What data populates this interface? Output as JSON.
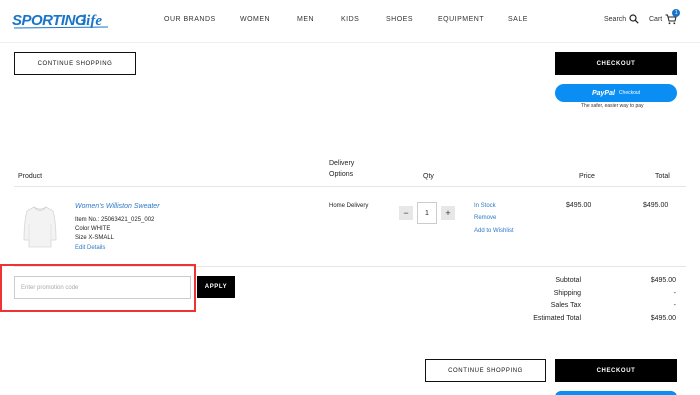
{
  "header": {
    "logo_text": "SPORTING LIFE",
    "nav": [
      "OUR BRANDS",
      "WOMEN",
      "MEN",
      "KIDS",
      "SHOES",
      "EQUIPMENT",
      "SALE"
    ],
    "search_label": "Search",
    "cart_label": "Cart",
    "cart_count": "1"
  },
  "top_actions": {
    "continue_label": "CONTINUE SHOPPING",
    "checkout_label": "CHECKOUT",
    "paypal_label": "PayPal",
    "paypal_sub": "Checkout",
    "paypal_caption": "The safer, easier way to pay"
  },
  "table": {
    "headers": {
      "product": "Product",
      "delivery_line1": "Delivery",
      "delivery_line2": "Options",
      "qty": "Qty",
      "price": "Price",
      "total": "Total"
    },
    "item": {
      "name": "Women's Williston Sweater",
      "item_no": "Item No.: 25063421_025_002",
      "color": "Color WHITE",
      "size": "Size X-SMALL",
      "edit_label": "Edit Details",
      "delivery": "Home Delivery",
      "qty_minus": "−",
      "qty_value": "1",
      "qty_plus": "+",
      "stock": "In Stock",
      "remove": "Remove",
      "wishlist": "Add to Wishlist",
      "price": "$495.00",
      "total": "$495.00"
    }
  },
  "promo": {
    "placeholder": "Enter promotion code",
    "apply_label": "APPLY"
  },
  "summary": {
    "subtotal_label": "Subtotal",
    "subtotal": "$495.00",
    "shipping_label": "Shipping",
    "shipping": "-",
    "tax_label": "Sales Tax",
    "tax": "-",
    "estimated_label": "Estimated Total",
    "estimated": "$495.00"
  },
  "bottom_actions": {
    "continue_label": "CONTINUE SHOPPING",
    "checkout_label": "CHECKOUT"
  },
  "colors": {
    "link": "#2e79c6",
    "paypal": "#0a8ef3",
    "highlight": "#e33333",
    "black": "#000000"
  }
}
